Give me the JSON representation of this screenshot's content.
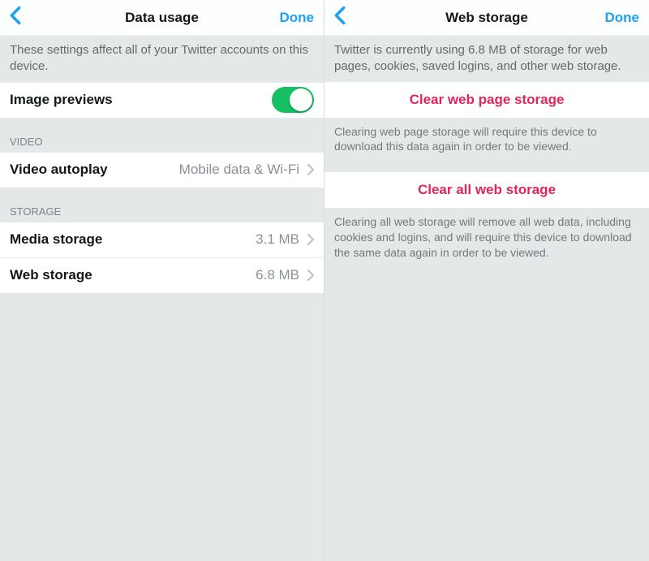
{
  "left": {
    "header": {
      "title": "Data usage",
      "done": "Done"
    },
    "intro": "These settings affect all of your Twitter accounts on this device.",
    "imagePreviews": {
      "label": "Image previews",
      "on": true
    },
    "videoSection": {
      "heading": "VIDEO",
      "autoplay": {
        "label": "Video autoplay",
        "value": "Mobile data & Wi-Fi"
      }
    },
    "storageSection": {
      "heading": "STORAGE",
      "media": {
        "label": "Media storage",
        "value": "3.1 MB"
      },
      "web": {
        "label": "Web storage",
        "value": "6.8 MB"
      }
    }
  },
  "right": {
    "header": {
      "title": "Web storage",
      "done": "Done"
    },
    "intro": "Twitter is currently using 6.8 MB of storage for web pages, cookies, saved logins, and other web storage.",
    "clearPage": {
      "label": "Clear web page storage",
      "footer": "Clearing web page storage will require this device to download this data again in order to be viewed."
    },
    "clearAll": {
      "label": "Clear all web storage",
      "footer": "Clearing all web storage will remove all web data, including cookies and logins, and will require this device to download the same data again in order to be viewed."
    }
  }
}
